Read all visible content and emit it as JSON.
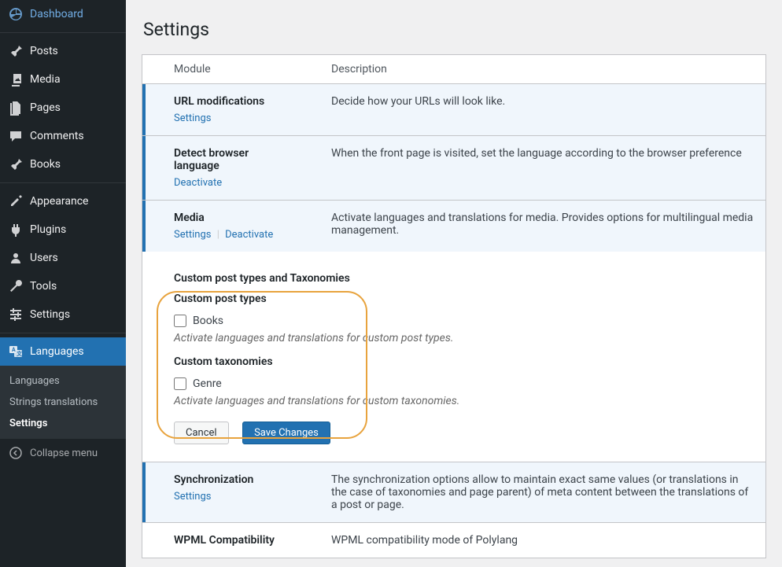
{
  "sidebar": {
    "items": [
      {
        "label": "Dashboard",
        "icon": "dashboard"
      },
      {
        "label": "Posts",
        "icon": "pin"
      },
      {
        "label": "Media",
        "icon": "media"
      },
      {
        "label": "Pages",
        "icon": "pages"
      },
      {
        "label": "Comments",
        "icon": "comments"
      },
      {
        "label": "Books",
        "icon": "pin"
      },
      {
        "label": "Appearance",
        "icon": "appearance"
      },
      {
        "label": "Plugins",
        "icon": "plugins"
      },
      {
        "label": "Users",
        "icon": "users"
      },
      {
        "label": "Tools",
        "icon": "tools"
      },
      {
        "label": "Settings",
        "icon": "settings"
      },
      {
        "label": "Languages",
        "icon": "languages"
      }
    ],
    "submenu": [
      {
        "label": "Languages"
      },
      {
        "label": "Strings translations"
      },
      {
        "label": "Settings"
      }
    ],
    "collapse": "Collapse menu"
  },
  "page": {
    "title": "Settings"
  },
  "table": {
    "headers": {
      "module": "Module",
      "description": "Description"
    },
    "rows": [
      {
        "name": "URL modifications",
        "links": [
          {
            "label": "Settings"
          }
        ],
        "desc": "Decide how your URLs will look like.",
        "active": true
      },
      {
        "name": "Detect browser language",
        "links": [
          {
            "label": "Deactivate"
          }
        ],
        "desc": "When the front page is visited, set the language according to the browser preference",
        "active": true
      },
      {
        "name": "Media",
        "links": [
          {
            "label": "Settings"
          },
          {
            "label": "Deactivate"
          }
        ],
        "desc": "Activate languages and translations for media. Provides options for multilingual media management.",
        "active": true
      },
      {
        "name": "Synchronization",
        "links": [
          {
            "label": "Settings"
          }
        ],
        "desc": "The synchronization options allow to maintain exact same values (or translations in the case of taxonomies and page parent) of meta content between the translations of a post or page.",
        "active": true
      },
      {
        "name": "WPML Compatibility",
        "links": [],
        "desc": "WPML compatibility mode of Polylang",
        "active": false
      }
    ],
    "expanded": {
      "section_title": "Custom post types and Taxonomies",
      "cpt_title": "Custom post types",
      "cpt_items": [
        {
          "label": "Books"
        }
      ],
      "cpt_hint": "Activate languages and translations for custom post types.",
      "tax_title": "Custom taxonomies",
      "tax_items": [
        {
          "label": "Genre"
        }
      ],
      "tax_hint": "Activate languages and translations for custom taxonomies.",
      "cancel": "Cancel",
      "save": "Save Changes"
    }
  }
}
